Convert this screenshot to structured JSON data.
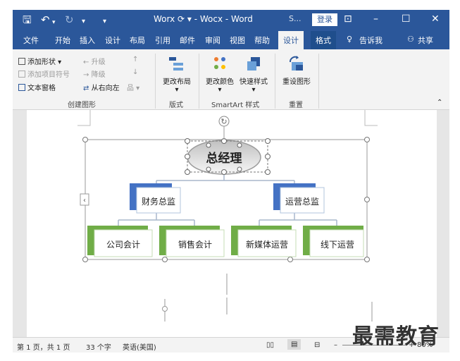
{
  "titlebar": {
    "doc_title": "Worx ⟳ ▾ - Wocx - Word",
    "s_button": "S...",
    "login_label": "登录"
  },
  "tabs": [
    "文件",
    "开始",
    "插入",
    "设计",
    "布局",
    "引用",
    "邮件",
    "审阅",
    "视图",
    "帮助",
    "设计",
    "格式",
    "告诉我",
    "共享"
  ],
  "ribbon": {
    "add_shape": "添加形状",
    "add_bullet": "添加项目符号",
    "text_pane": "文本窗格",
    "promote": "升级",
    "demote": "降级",
    "right_to_left": "从右向左",
    "change_layout": "更改布局",
    "change_colors": "更改颜色",
    "quick_styles": "快速样式",
    "reset_graphic": "重设图形",
    "group_create": "创建图形",
    "group_layout": "版式",
    "group_styles": "SmartArt 样式",
    "group_reset": "重置"
  },
  "org_chart": {
    "root": "总经理",
    "level1": [
      "财务总监",
      "运营总监"
    ],
    "level2": [
      "公司会计",
      "销售会计",
      "新媒体运营",
      "线下运营"
    ]
  },
  "status": {
    "page": "第 1 页，共 1 页",
    "words": "33 个字",
    "language": "英语(美国)",
    "zoom": "80%"
  },
  "watermark": "最需教育",
  "colors": {
    "brand_blue": "#2b579a",
    "green_accent": "#70ad47",
    "blue_accent": "#4472c4"
  }
}
